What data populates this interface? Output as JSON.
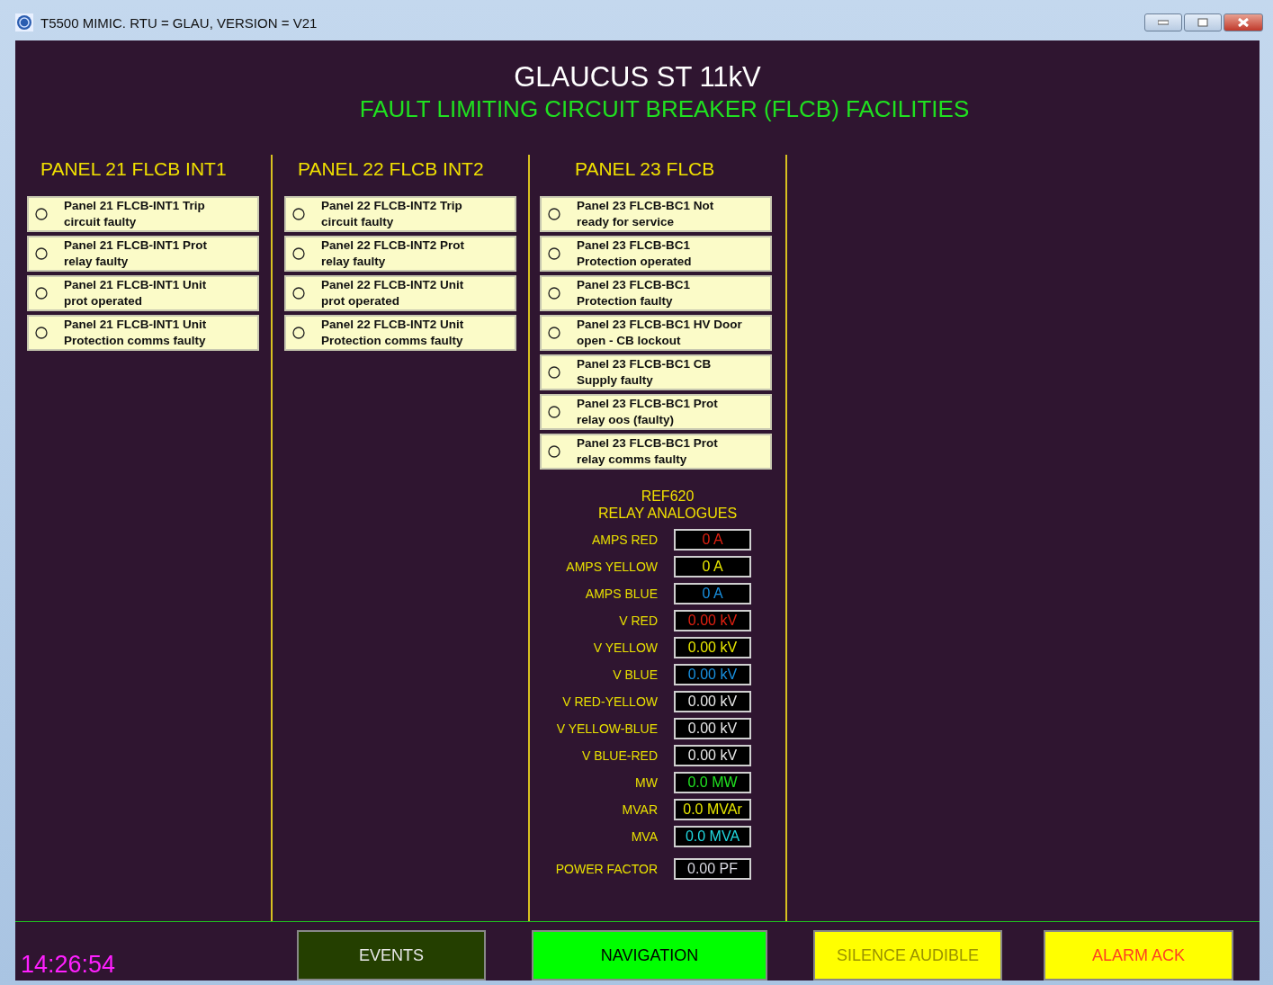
{
  "window": {
    "title": "T5500 MIMIC.  RTU = GLAU, VERSION = V21"
  },
  "header": {
    "title": "GLAUCUS ST 11kV",
    "subtitle": "FAULT LIMITING CIRCUIT BREAKER (FLCB) FACILITIES"
  },
  "panels": [
    {
      "title": "PANEL 21 FLCB INT1",
      "alarms": [
        "Panel 21 FLCB-INT1 Trip circuit faulty",
        "Panel 21 FLCB-INT1 Prot relay faulty",
        "Panel 21 FLCB-INT1 Unit prot operated",
        "Panel 21 FLCB-INT1 Unit Protection comms faulty"
      ]
    },
    {
      "title": "PANEL 22 FLCB INT2",
      "alarms": [
        "Panel 22 FLCB-INT2 Trip circuit faulty",
        "Panel 22 FLCB-INT2 Prot relay faulty",
        "Panel 22 FLCB-INT2 Unit prot operated",
        "Panel 22 FLCB-INT2 Unit Protection comms faulty"
      ]
    },
    {
      "title": "PANEL 23 FLCB",
      "alarms": [
        "Panel 23 FLCB-BC1 Not ready for service",
        "Panel 23 FLCB-BC1 Protection operated",
        "Panel 23 FLCB-BC1 Protection faulty",
        "Panel 23 FLCB-BC1 HV Door open - CB lockout",
        "Panel 23 FLCB-BC1 CB Supply faulty",
        "Panel 23 FLCB-BC1 Prot relay oos (faulty)",
        "Panel 23 FLCB-BC1 Prot relay comms faulty"
      ],
      "analogues": {
        "title": [
          "REF620",
          "RELAY ANALOGUES"
        ],
        "rows": [
          {
            "label": "AMPS RED",
            "value": "0 A",
            "kind": "red"
          },
          {
            "label": "AMPS YELLOW",
            "value": "0 A",
            "kind": "yellow"
          },
          {
            "label": "AMPS BLUE",
            "value": "0 A",
            "kind": "blue"
          },
          {
            "label": "V RED",
            "value": "0.00 kV",
            "kind": "red"
          },
          {
            "label": "V YELLOW",
            "value": "0.00 kV",
            "kind": "yellow"
          },
          {
            "label": "V BLUE",
            "value": "0.00 kV",
            "kind": "blue"
          },
          {
            "label": "V RED-YELLOW",
            "value": "0.00 kV",
            "kind": "line"
          },
          {
            "label": "V YELLOW-BLUE",
            "value": "0.00 kV",
            "kind": "line"
          },
          {
            "label": "V BLUE-RED",
            "value": "0.00 kV",
            "kind": "line"
          },
          {
            "label": "MW",
            "value": "0.0 MW",
            "kind": "active"
          },
          {
            "label": "MVAR",
            "value": "0.0 MVAr",
            "kind": "reactive"
          },
          {
            "label": "MVA",
            "value": "0.0 MVA",
            "kind": "apparent"
          },
          {
            "label": "POWER FACTOR",
            "value": "0.00 PF",
            "kind": "factor"
          }
        ]
      }
    }
  ],
  "footer": {
    "time": "14:26:54",
    "buttons": [
      {
        "label": "EVENTS",
        "color": "#243f00",
        "kind": "light"
      },
      {
        "label": "NAVIGATION",
        "color": "#00ff00",
        "kind": "dark"
      },
      {
        "label": "SILENCE AUDIBLE",
        "color": "#ffff00",
        "kind": "pale"
      },
      {
        "label": "ALARM ACK",
        "color": "#ffff00",
        "kind": "alert"
      }
    ]
  }
}
